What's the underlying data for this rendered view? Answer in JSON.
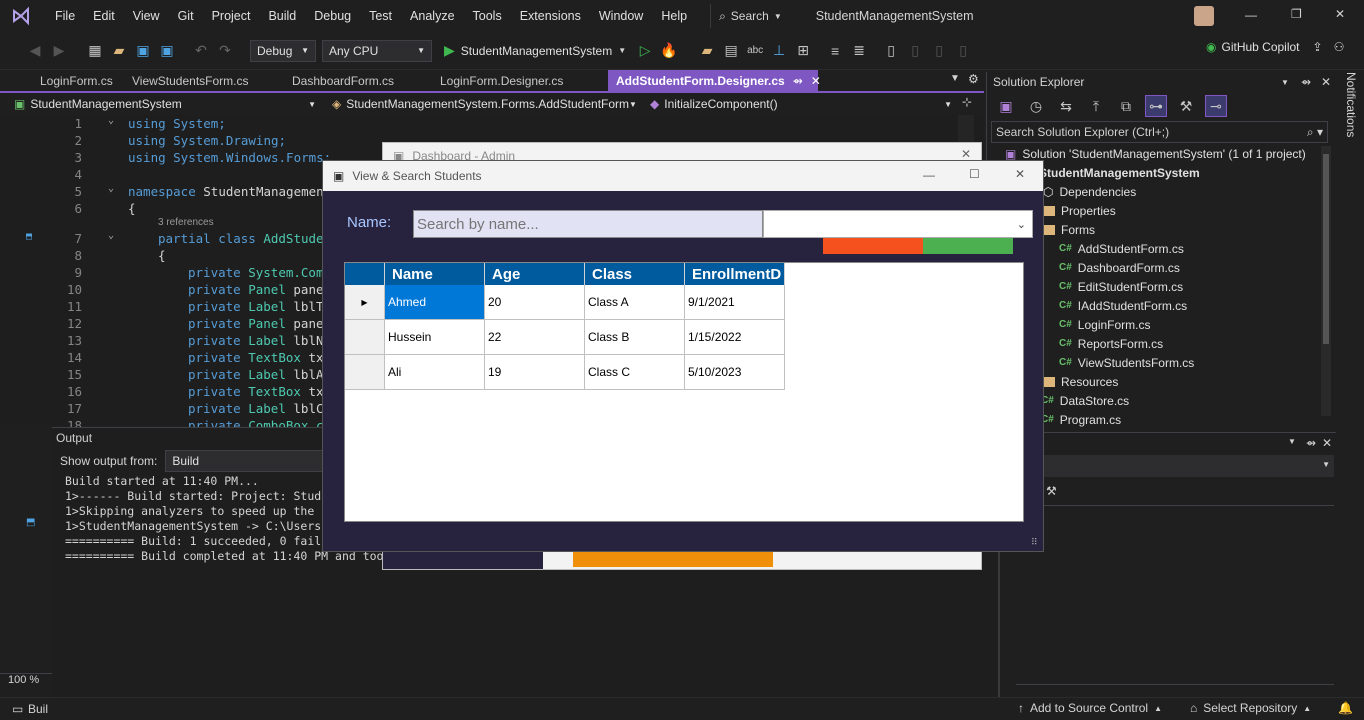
{
  "menu": {
    "items": [
      "File",
      "Edit",
      "View",
      "Git",
      "Project",
      "Build",
      "Debug",
      "Test",
      "Analyze",
      "Tools",
      "Extensions",
      "Window",
      "Help"
    ],
    "search_label": "Search",
    "solution_title": "StudentManagementSystem"
  },
  "toolbar": {
    "config": "Debug",
    "platform": "Any CPU",
    "run_target": "StudentManagementSystem",
    "copilot": "GitHub Copilot"
  },
  "tabs": [
    "LoginForm.cs",
    "ViewStudentsForm.cs",
    "DashboardForm.cs",
    "LoginForm.Designer.cs",
    "AddStudentForm.Designer.cs"
  ],
  "navbar": {
    "project": "StudentManagementSystem",
    "class": "StudentManagementSystem.Forms.AddStudentForm",
    "member": "InitializeComponent()"
  },
  "editor": {
    "line_numbers": [
      "1",
      "2",
      "3",
      "4",
      "5",
      "6",
      "7",
      "8",
      "9",
      "10",
      "11",
      "12",
      "13",
      "14",
      "15",
      "16",
      "17",
      "18"
    ],
    "lines": {
      "l1": "using System;",
      "l2": "using System.Drawing;",
      "l3": "using System.Windows.Forms;",
      "l5a": "namespace ",
      "l5b": "StudentManagemen",
      "l6": "{",
      "refs": "3 references",
      "l7a": "partial class ",
      "l7b": "AddStude",
      "l8": "{",
      "l9": "System.Com",
      "l10": "pane",
      "l11": "lblT",
      "l12": "pane",
      "l13": "lblN",
      "l14": "tx",
      "l15": "lblA",
      "l16": "tx",
      "l17": "lblC",
      "l18": "ComboBox c",
      "kw_private": "private",
      "ty_panel": "Panel",
      "ty_label": "Label",
      "ty_textbox": "TextBox"
    },
    "zoom": "100 %"
  },
  "output": {
    "title": "Output",
    "show_from_label": "Show output from:",
    "source": "Build",
    "lines": [
      "Build started at 11:40 PM...",
      "1>------ Build started: Project: Stud",
      "1>Skipping analyzers to speed up the",
      "1>StudentManagementSystem -> C:\\Users",
      "========== Build: 1 succeeded, 0 fail",
      "========== Build completed at 11:40 PM and too"
    ]
  },
  "solution_explorer": {
    "title": "Solution Explorer",
    "search_placeholder": "Search Solution Explorer (Ctrl+;)",
    "solution": "Solution 'StudentManagementSystem' (1 of 1 project)",
    "project": "StudentManagementSystem",
    "items": {
      "dependencies": "Dependencies",
      "properties": "Properties",
      "forms": "Forms",
      "f1": "AddStudentForm.cs",
      "f2": "DashboardForm.cs",
      "f3": "EditStudentForm.cs",
      "f4": "IAddStudentForm.cs",
      "f5": "LoginForm.cs",
      "f6": "ReportsForm.cs",
      "f7": "ViewStudentsForm.cs",
      "resources": "Resources",
      "datastore": "DataStore.cs",
      "program": "Program.cs"
    },
    "cs_badge": "C#"
  },
  "notifications_label": "Notifications",
  "statusbar": {
    "left": "Buil",
    "source_control": "Add to Source Control",
    "repository": "Select Repository"
  },
  "dashboard_window": {
    "title": "Dashboard - Admin"
  },
  "view_window": {
    "title": "View & Search Students",
    "name_label": "Name:",
    "search_placeholder": "Search by name...",
    "grid": {
      "columns": [
        "Name",
        "Age",
        "Class",
        "EnrollmentD"
      ],
      "rows": [
        [
          "Ahmed",
          "20",
          "Class A",
          "9/1/2021"
        ],
        [
          "Hussein",
          "22",
          "Class B",
          "1/15/2022"
        ],
        [
          "Ali",
          "19",
          "Class C",
          "5/10/2023"
        ]
      ]
    },
    "colors": {
      "background": "#27233f",
      "orange_button": "#f4511e",
      "green_button": "#4caf50",
      "header": "#005a9e",
      "selected": "#0078d7"
    }
  }
}
